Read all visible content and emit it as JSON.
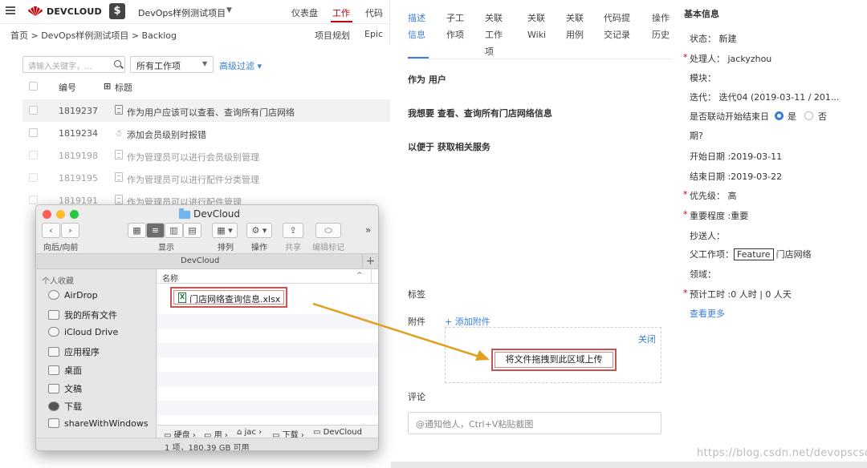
{
  "topbar": {
    "brand": "DEVCLOUD",
    "project_icon": "$",
    "project_name": "DevOps样例测试项目",
    "nav": [
      "仪表盘",
      "工作",
      "代码"
    ]
  },
  "breadcrumb": {
    "text": "首页 > DevOps样例测试项目 > Backlog",
    "right_links": [
      "项目规划",
      "Epic"
    ]
  },
  "filters": {
    "search_placeholder": "请输入关键字，...",
    "select_value": "所有工作项",
    "advanced": "高级过滤"
  },
  "table": {
    "headers": [
      "编号",
      "标题"
    ],
    "rows": [
      {
        "id": "1819237",
        "title": "作为用户应该可以查看、查询所有门店网络"
      },
      {
        "id": "1819234",
        "title": "添加会员级别时报错"
      },
      {
        "id": "1819198",
        "title": "作为管理员可以进行会员级别管理"
      },
      {
        "id": "1819195",
        "title": "作为管理员可以进行配件分类管理"
      },
      {
        "id": "1819191",
        "title": "作为管理员可以进行配件管理"
      }
    ]
  },
  "detail": {
    "tabs": [
      {
        "line1": "描述",
        "line2": "信息"
      },
      {
        "line1": "子工",
        "line2": "作项"
      },
      {
        "line1": "关联",
        "line2": "工作",
        "line3": "项"
      },
      {
        "line1": "关联",
        "line2": "Wiki"
      },
      {
        "line1": "关联",
        "line2": "用例"
      },
      {
        "line1": "代码提",
        "line2": "交记录"
      },
      {
        "line1": "操作",
        "line2": "历史"
      }
    ],
    "as_a": "作为 用户",
    "i_want": "我想要 查看、查询所有门店网络信息",
    "so_that": "以便于 获取相关服务",
    "tags_label": "标签",
    "attach_label": "附件",
    "attach_add": "+ 添加附件",
    "dropzone_close": "关闭",
    "dropzone_text": "将文件拖拽到此区域上传",
    "comment_label": "评论",
    "comment_placeholder": "@通知他人，Ctrl+V粘贴截图"
  },
  "info": {
    "title": "基本信息",
    "status": "状态：   新建",
    "handler": "处理人：  jackyzhou",
    "module": "模块：",
    "iteration": "迭代：   迭代04 (2019-03-11 / 201...",
    "link_end_1": "是否联动开始结束日",
    "radio_yes": "是",
    "radio_no": "否",
    "link_end_2": "期?",
    "start_date": "开始日期 :2019-03-11",
    "end_date": "结束日期 :2019-03-22",
    "priority": "优先级：  高",
    "severity": "重要程度 :重要",
    "cc": "抄送人：",
    "parent_label": "父工作项：",
    "parent_tag": "Feature",
    "parent_value": "门店网络",
    "domain": "领域：",
    "estimate": "预计工时 :0 人时    |     0 人天",
    "see_more": "查看更多"
  },
  "finder": {
    "title": "DevCloud",
    "toolbar_labels": [
      "向后/向前",
      "显示",
      "排列",
      "操作",
      "共享",
      "编辑标记"
    ],
    "path_title": "DevCloud",
    "sidebar_head": "个人收藏",
    "sidebar_items": [
      "AirDrop",
      "我的所有文件",
      "iCloud Drive",
      "应用程序",
      "桌面",
      "文稿",
      "下载",
      "shareWithWindows"
    ],
    "column_name": "名称",
    "file": "门店网络查询信息.xlsx",
    "path": [
      "硬盘",
      "用",
      "jac",
      "下载",
      "DevCloud"
    ],
    "status": "1 项，180.39 GB 可用"
  },
  "watermark": "https://blog.csdn.net/devopscsdn",
  "colors": {
    "accent_red": "#c7000b",
    "accent_blue": "#3a7fd5",
    "highlight_border": "#c9534f",
    "arrow": "#e0a020"
  }
}
